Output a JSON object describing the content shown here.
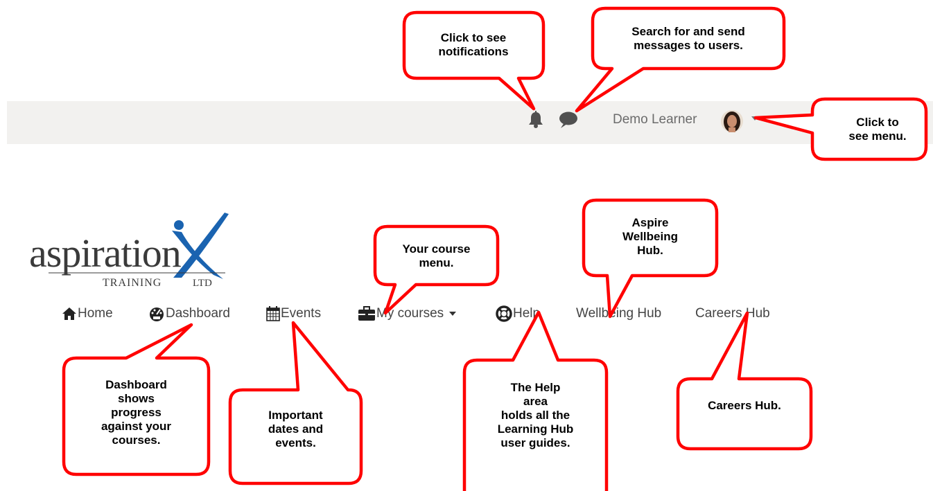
{
  "colors": {
    "callout_border": "#ff0000",
    "topbar_bg": "#f2f1ef",
    "logo_blue": "#1a63b0",
    "text_gray": "#444444"
  },
  "topbar": {
    "user_name": "Demo Learner",
    "icons": [
      "bell-icon",
      "chat-bubble-icon",
      "avatar",
      "chevron-down-icon"
    ]
  },
  "logo": {
    "word": "aspiration",
    "sub_left": "TRAINING",
    "sub_right": "LTD"
  },
  "nav": {
    "items": [
      {
        "label": "Home",
        "icon": "home-icon"
      },
      {
        "label": "Dashboard",
        "icon": "dashboard-gauge-icon"
      },
      {
        "label": "Events",
        "icon": "calendar-icon"
      },
      {
        "label": "My courses",
        "icon": "briefcase-icon"
      },
      {
        "label": "Help",
        "icon": "lifebuoy-icon"
      },
      {
        "label": "Wellbeing Hub"
      },
      {
        "label": "Careers Hub"
      }
    ]
  },
  "callouts": {
    "notifications": "Click to see\nnotifications",
    "messages": "Search for and send\nmessages to users.",
    "menu": "Click to\nsee menu.",
    "courses": "Your course\nmenu.",
    "wellbeing": "Aspire\nWellbeing\nHub.",
    "dashboard": "Dashboard\nshows\nprogress\nagainst your\ncourses.",
    "events": "Important\ndates and\nevents.",
    "help": "The Help\narea\nholds all the\nLearning Hub\nuser guides.",
    "careers": "Careers Hub."
  }
}
